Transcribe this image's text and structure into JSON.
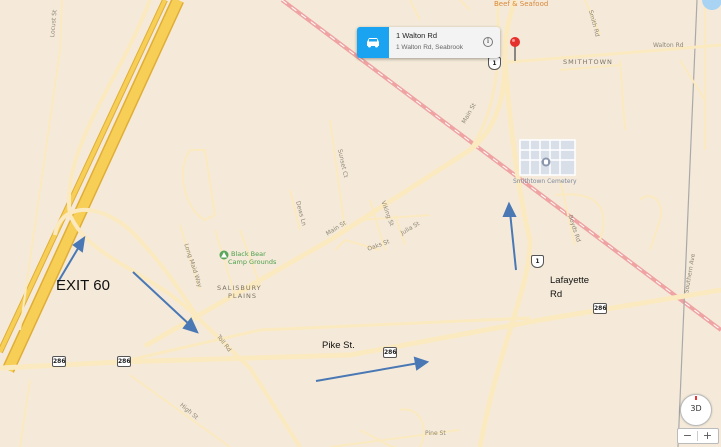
{
  "map": {
    "callout": {
      "title": "1 Walton Rd",
      "subtitle": "1 Walton Rd, Seabrook",
      "car_icon": "car-icon",
      "info_icon": "info-icon"
    },
    "top_label": "Beef & Seafood",
    "place_labels": {
      "smithtown": "SMITHTOWN",
      "cemetery": "Smithtown Cemetery",
      "camp_line1": "Black Bear",
      "camp_line2": "Camp Grounds",
      "salisbury_line1": "SALISBURY",
      "salisbury_line2": "PLAINS"
    },
    "street_labels": {
      "walton": "Walton Rd",
      "main_upper": "Main St",
      "main_lower": "Main St",
      "toll": "Toll Rd",
      "high": "High St",
      "pine": "Pine St",
      "locust": "Locust St",
      "long_meadow": "Long Maid Way",
      "dews": "Dews Ln",
      "viking": "Viking St",
      "oaks": "Oaks St",
      "julia": "Julia St",
      "sunset": "Sunset Ct",
      "boyds": "Boyds Rd",
      "smith": "Smith Rd",
      "southern": "Southern Ave"
    },
    "shields": {
      "route1_top": "1",
      "route1_mid": "1",
      "r286_right": "286",
      "r286_mid": "286",
      "r286_left1": "286",
      "r286_left2": "286"
    },
    "annotations": {
      "exit": "EXIT 60",
      "lafayette_line1": "Lafayette",
      "lafayette_line2": "Rd",
      "pike": "Pike St."
    },
    "controls": {
      "compass_label": "3D",
      "zoom_out": "−",
      "zoom_in": "+"
    },
    "colors": {
      "land": "#f5ead9",
      "highway": "#f7c84a",
      "arrow": "#4a78b5",
      "rail": "#ef9a9a",
      "accent": "#1aa3f0"
    }
  }
}
